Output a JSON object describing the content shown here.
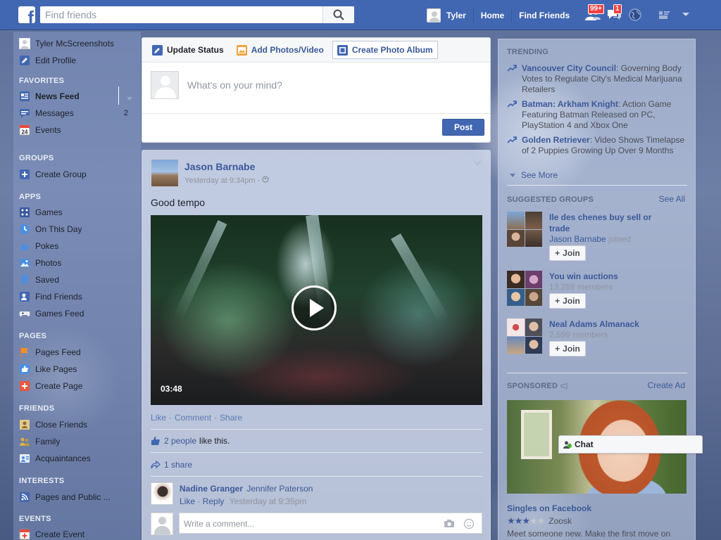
{
  "topbar": {
    "logo": "f",
    "search_placeholder": "Find friends",
    "user_name": "Tyler",
    "home": "Home",
    "find_friends": "Find Friends",
    "friend_requests_badge": "99+",
    "messages_badge": "1"
  },
  "left_nav": {
    "profile_name": "Tyler McScreenshots",
    "edit_profile": "Edit Profile",
    "favorites_header": "FAVORITES",
    "news_feed": "News Feed",
    "messages": "Messages",
    "messages_count": "2",
    "events": "Events",
    "events_calendar_day": "24",
    "groups_header": "GROUPS",
    "create_group": "Create Group",
    "apps_header": "APPS",
    "games": "Games",
    "on_this_day": "On This Day",
    "pokes": "Pokes",
    "photos": "Photos",
    "saved": "Saved",
    "find_friends": "Find Friends",
    "games_feed": "Games Feed",
    "pages_header": "PAGES",
    "pages_feed": "Pages Feed",
    "like_pages": "Like Pages",
    "create_page": "Create Page",
    "friends_header": "FRIENDS",
    "close_friends": "Close Friends",
    "family": "Family",
    "acquaintances": "Acquaintances",
    "interests_header": "INTERESTS",
    "pages_and_public": "Pages and Public ...",
    "events_header": "EVENTS",
    "create_event": "Create Event"
  },
  "composer": {
    "tab_update_status": "Update Status",
    "tab_add_photos": "Add Photos/Video",
    "tab_create_album": "Create Photo Album",
    "placeholder": "What's on your mind?",
    "post_button": "Post"
  },
  "story": {
    "author": "Jason Barnabe",
    "timestamp": "Yesterday at 9:34pm",
    "time_separator": "·",
    "text": "Good tempo",
    "video_duration": "03:48",
    "action_like": "Like",
    "action_comment": "Comment",
    "action_share": "Share",
    "action_separator": "·",
    "likes_link": "2 people",
    "likes_suffix": "like this.",
    "shares": "1 share",
    "comment_author": "Nadine Granger",
    "comment_text": "Jennifer Paterson",
    "comment_like": "Like",
    "comment_reply": "Reply",
    "comment_time": "Yesterday at 9:35pm",
    "comment_placeholder": "Write a comment..."
  },
  "trending": {
    "header": "TRENDING",
    "items": [
      {
        "topic": "Vancouver City Council",
        "desc": ": Governing Body Votes to Regulate City's Medical Marijuana Retailers"
      },
      {
        "topic": "Batman: Arkham Knight",
        "desc": ": Action Game Featuring Batman Released on PC, PlayStation 4 and Xbox One"
      },
      {
        "topic": "Golden Retriever",
        "desc": ": Video Shows Timelapse of 2 Puppies Growing Up Over 9 Months"
      }
    ],
    "see_more": "See More"
  },
  "suggested_groups": {
    "header": "SUGGESTED GROUPS",
    "see_all": "See All",
    "join_label": "Join",
    "groups": [
      {
        "name": "Ile des chenes buy sell or trade",
        "member": "Jason Barnabe",
        "sub": " joined"
      },
      {
        "name": "You win auctions",
        "sub": "13,288 members"
      },
      {
        "name": "Neal Adams Almanack",
        "sub": "2,599 members"
      }
    ]
  },
  "sponsored": {
    "header": "SPONSORED",
    "create_ad": "Create Ad",
    "ad_title": "Singles on Facebook",
    "ad_source": "Zoosk",
    "ad_rating": 3,
    "ad_body": "Meet someone new. Make the first move on"
  },
  "chat": {
    "label": "Chat"
  },
  "colors": {
    "brand_blue": "#4267b2",
    "link_blue": "#3b5998",
    "badge_red": "#fa3e3e",
    "online_green": "#42b72a"
  }
}
